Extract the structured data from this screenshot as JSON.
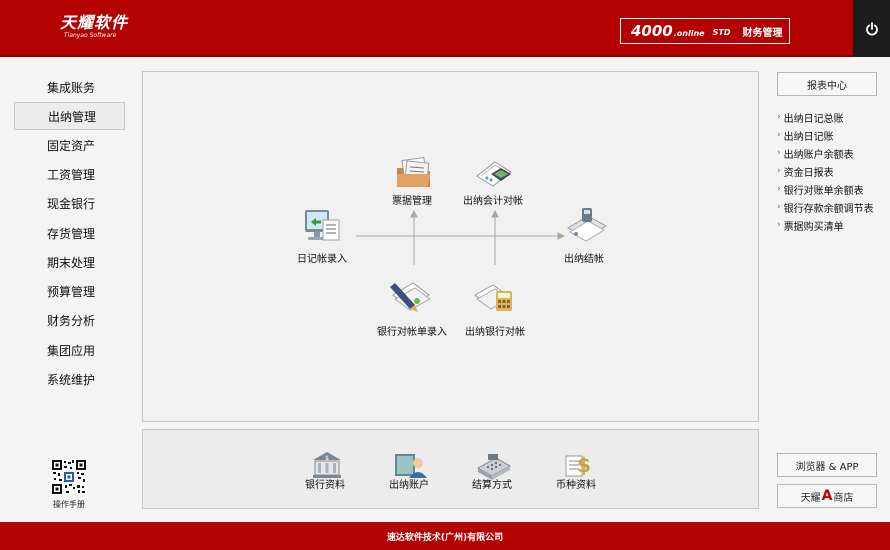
{
  "header": {
    "logo_cn": "天耀软件",
    "logo_en": "Tianyao Software",
    "product_number": "4000",
    "product_online": ".online",
    "product_edition": "STD",
    "product_name": "财务管理",
    "power_icon": "power-icon"
  },
  "sidebar": {
    "items": [
      {
        "label": "集成账务"
      },
      {
        "label": "出纳管理",
        "active": true
      },
      {
        "label": "固定资产"
      },
      {
        "label": "工资管理"
      },
      {
        "label": "现金银行"
      },
      {
        "label": "存货管理"
      },
      {
        "label": "期末处理"
      },
      {
        "label": "预算管理"
      },
      {
        "label": "财务分析"
      },
      {
        "label": "集团应用"
      },
      {
        "label": "系统维护"
      }
    ],
    "qr_label": "操作手册"
  },
  "flow": {
    "journal_entry": "日记帐录入",
    "bill_management": "票据管理",
    "cashier_accounting_reconcile": "出纳会计对帐",
    "cashier_closing": "出纳结帐",
    "bank_statement_entry": "银行对帐单录入",
    "cashier_bank_reconcile": "出纳银行对帐"
  },
  "bottom": {
    "items": [
      {
        "label": "银行资料",
        "icon": "bank-icon"
      },
      {
        "label": "出纳账户",
        "icon": "account-user-icon"
      },
      {
        "label": "结算方式",
        "icon": "cash-register-icon"
      },
      {
        "label": "币种资料",
        "icon": "currency-icon"
      }
    ]
  },
  "right": {
    "report_center": "报表中心",
    "reports": [
      "出纳日记总账",
      "出纳日记账",
      "出纳账户余额表",
      "资金日报表",
      "银行对账单余额表",
      "银行存款余额调节表",
      "票据购买清单"
    ],
    "browser_app": "浏览器 & APP",
    "store_prefix": "天耀",
    "store_letter": "A",
    "store_suffix": "商店"
  },
  "footer": {
    "text": "速达软件技术(广州)有限公司"
  },
  "colors": {
    "brand_red": "#b30000",
    "dark": "#1c1c1c"
  }
}
